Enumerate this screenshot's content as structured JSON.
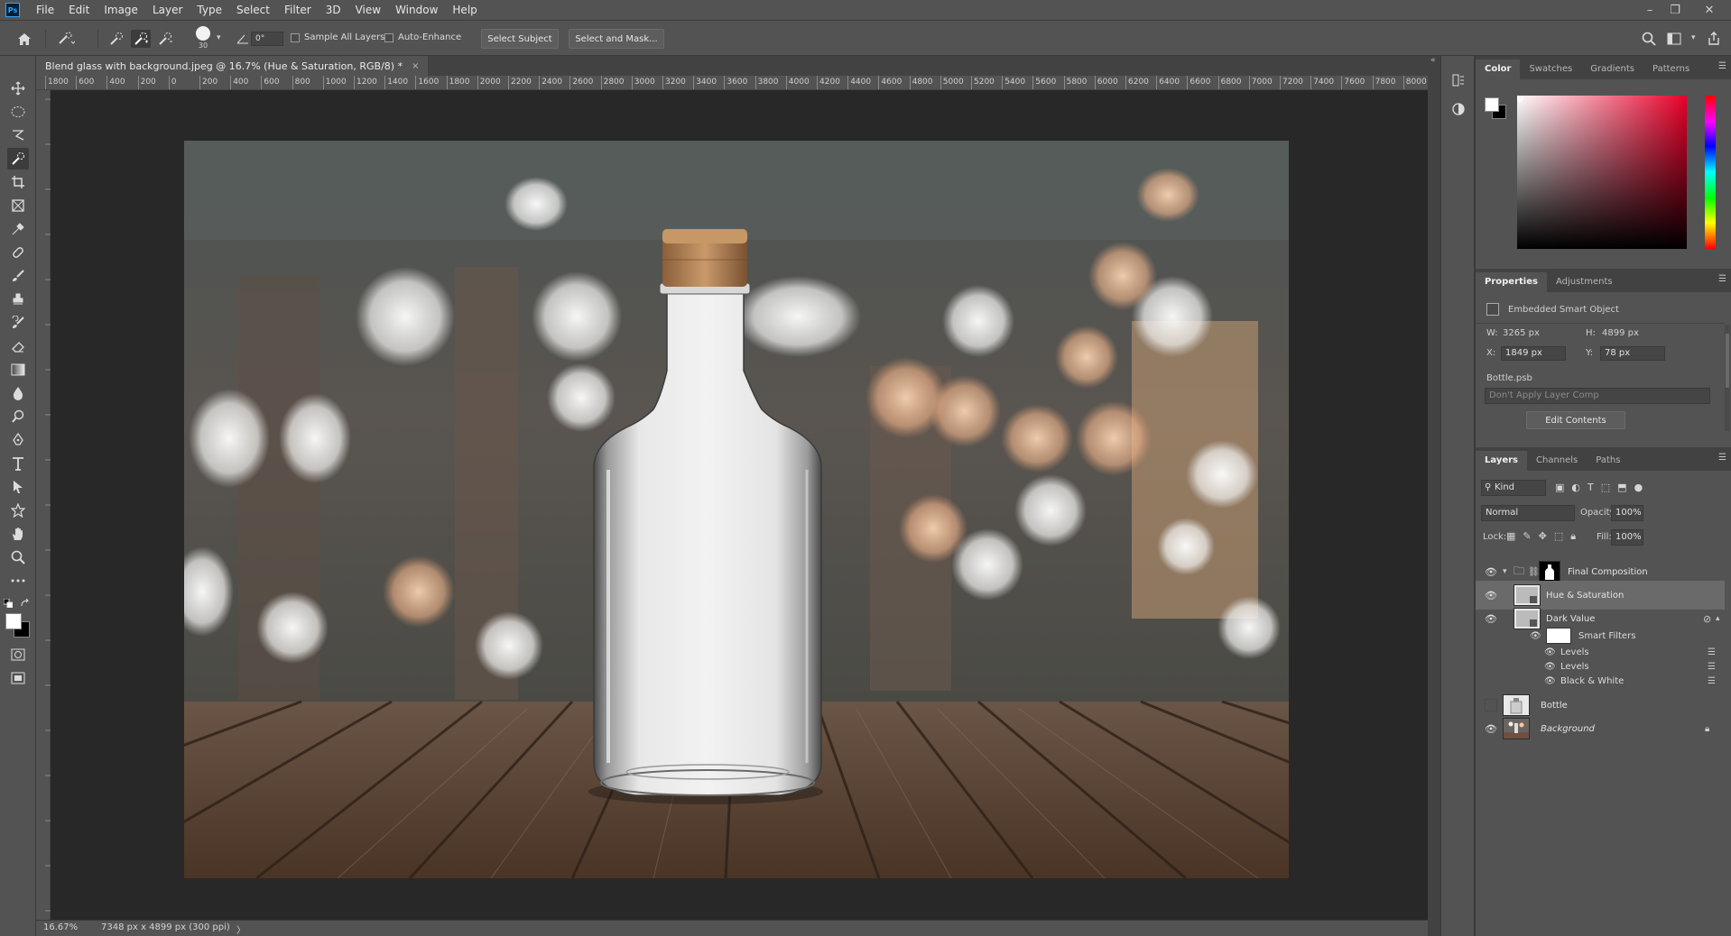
{
  "menu": {
    "logo": "Ps",
    "items": [
      "File",
      "Edit",
      "Image",
      "Layer",
      "Type",
      "Select",
      "Filter",
      "3D",
      "View",
      "Window",
      "Help"
    ]
  },
  "window_controls": {
    "minimize": "–",
    "restore": "❐",
    "close": "✕"
  },
  "options": {
    "brush_size": "30",
    "angle": "0°",
    "sample_all_layers": "Sample All Layers",
    "auto_enhance": "Auto-Enhance",
    "select_subject": "Select Subject",
    "select_and_mask": "Select and Mask..."
  },
  "document": {
    "tab_title": "Blend glass with background.jpeg @ 16.7% (Hue & Saturation, RGB/8) *",
    "close": "×",
    "ruler_ticks": [
      "1800",
      "600",
      "400",
      "200",
      "0",
      "200",
      "400",
      "600",
      "800",
      "1000",
      "1200",
      "1400",
      "1600",
      "1800",
      "2000",
      "2200",
      "2400",
      "2600",
      "2800",
      "3000",
      "3200",
      "3400",
      "3600",
      "3800",
      "4000",
      "4200",
      "4400",
      "4600",
      "4800",
      "5000",
      "5200",
      "5400",
      "5600",
      "5800",
      "6000",
      "6200",
      "6400",
      "6600",
      "6800",
      "7000",
      "7200",
      "7400",
      "7600",
      "7800",
      "8000"
    ]
  },
  "status": {
    "zoom": "16.67%",
    "doc_info": "7348 px x 4899 px (300 ppi)",
    "arrow": "〉"
  },
  "color_panel": {
    "tabs": [
      "Color",
      "Swatches",
      "Gradients",
      "Patterns"
    ],
    "active": "Color"
  },
  "properties_panel": {
    "tabs": [
      "Properties",
      "Adjustments"
    ],
    "object_type": "Embedded Smart Object",
    "w_label": "W:",
    "w_value": "3265 px",
    "h_label": "H:",
    "h_value": "4899 px",
    "x_label": "X:",
    "x_value": "1849 px",
    "y_label": "Y:",
    "y_value": "78 px",
    "file_name": "Bottle.psb",
    "layer_comp": "Don't Apply Layer Comp",
    "edit_contents": "Edit Contents"
  },
  "layers_panel": {
    "tabs": [
      "Layers",
      "Channels",
      "Paths"
    ],
    "filter_kind": "Kind",
    "blend_mode": "Normal",
    "opacity_label": "Opacity:",
    "opacity_value": "100%",
    "lock_label": "Lock:",
    "fill_label": "Fill:",
    "fill_value": "100%",
    "layers": [
      {
        "name": "Final Composition"
      },
      {
        "name": "Hue & Saturation"
      },
      {
        "name": "Dark Value"
      },
      {
        "name": "Smart Filters"
      },
      {
        "name": "Levels"
      },
      {
        "name": "Levels"
      },
      {
        "name": "Black & White"
      },
      {
        "name": "Bottle"
      },
      {
        "name": "Background"
      }
    ]
  },
  "colors": {
    "foreground": "#ffffff",
    "background": "#000000",
    "accent": "#31a8ff"
  }
}
